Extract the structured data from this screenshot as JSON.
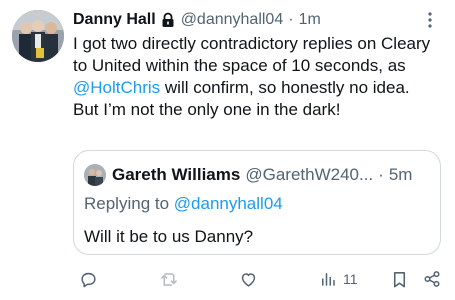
{
  "tweet": {
    "author_name": "Danny Hall",
    "handle": "@dannyhall04",
    "separator": "·",
    "time": "1m",
    "text_parts": [
      "I got two directly contradictory replies on Cleary to United within the space of 10 seconds, as ",
      "@HoltChris",
      " will confirm, so honestly no idea. But I’m not the only one in the dark!"
    ]
  },
  "quote": {
    "author_name": "Gareth Williams",
    "handle": "@GarethW240...",
    "separator": "·",
    "time": "5m",
    "reply_prefix": "Replying to ",
    "reply_handle": "@dannyhall04",
    "text": "Will it be to us Danny?"
  },
  "actions": {
    "views_count": "11"
  },
  "colors": {
    "accent": "#1d9bf0",
    "secondary_text": "#536471",
    "primary_text": "#0f1419",
    "border": "#cfd9de"
  },
  "icons": [
    "lock-icon",
    "more-icon",
    "reply-icon",
    "retweet-icon",
    "like-icon",
    "views-icon",
    "bookmark-icon",
    "share-icon"
  ]
}
